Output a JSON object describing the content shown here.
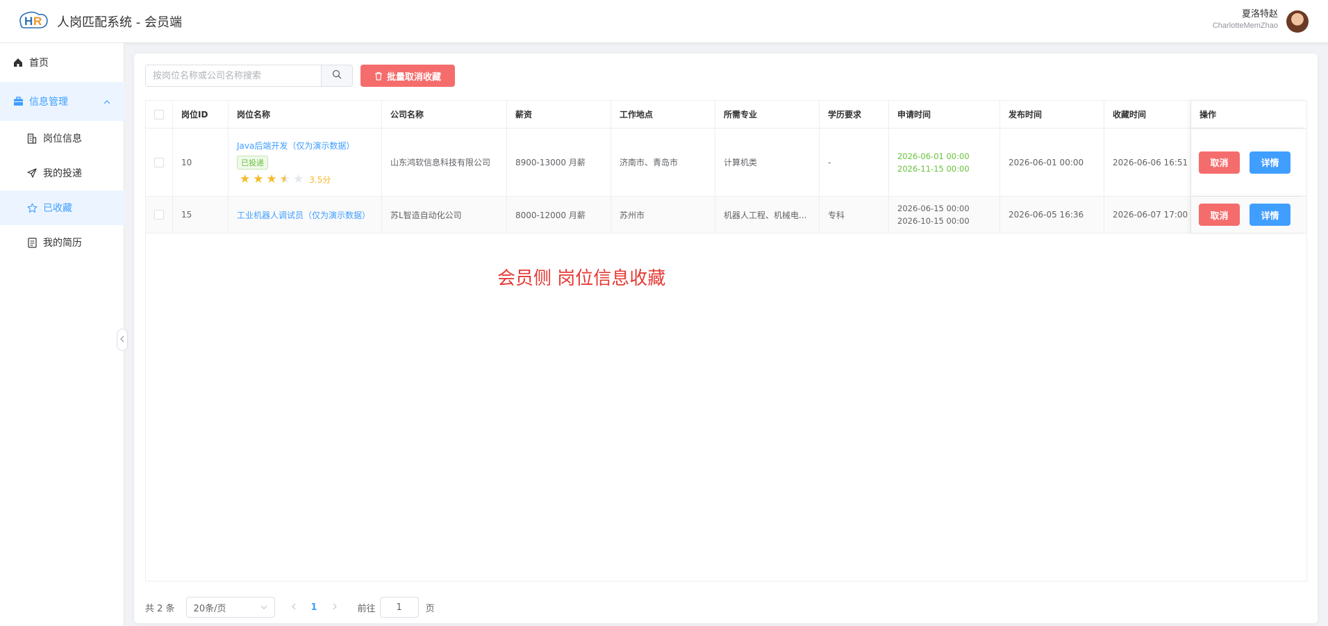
{
  "header": {
    "logo_text": "HR",
    "title": "人岗匹配系统 - 会员端",
    "user_name": "夏洛特赵",
    "user_sub": "CharlotteMemZhao"
  },
  "sidebar": {
    "items": [
      {
        "label": "首页",
        "icon": "home-icon"
      },
      {
        "label": "信息管理",
        "icon": "briefcase-icon"
      },
      {
        "label": "岗位信息",
        "icon": "building-icon"
      },
      {
        "label": "我的投递",
        "icon": "send-icon"
      },
      {
        "label": "已收藏",
        "icon": "star-icon"
      },
      {
        "label": "我的简历",
        "icon": "document-icon"
      }
    ]
  },
  "toolbar": {
    "search_placeholder": "按岗位名称或公司名称搜索",
    "batch_label": "批量取消收藏"
  },
  "table": {
    "headers": [
      "岗位ID",
      "岗位名称",
      "公司名称",
      "薪资",
      "工作地点",
      "所需专业",
      "学历要求",
      "申请时间",
      "发布时间",
      "收藏时间",
      "操作"
    ],
    "rows": [
      {
        "id": "10",
        "title": "Java后端开发（仅为演示数据）",
        "tag": "已投递",
        "rating": 3.5,
        "score": "3.5分",
        "company": "山东鸿软信息科技有限公司",
        "salary": "8900-13000 月薪",
        "location": "济南市、青岛市",
        "major": "计算机类",
        "education": "-",
        "apply_start": "2026-06-01 00:00",
        "apply_end": "2026-11-15 00:00",
        "publish_time": "2026-06-01 00:00",
        "fav_time": "2026-06-06 16:51"
      },
      {
        "id": "15",
        "title": "工业机器人调试员（仅为演示数据）",
        "company": "苏L智造自动化公司",
        "salary": "8000-12000 月薪",
        "location": "苏州市",
        "major": "机器人工程、机械电...",
        "education": "专科",
        "apply_start": "2026-06-15 00:00",
        "apply_end": "2026-10-15 00:00",
        "publish_time": "2026-06-05 16:36",
        "fav_time": "2026-06-07 17:00"
      }
    ],
    "cancel_label": "取消",
    "detail_label": "详情"
  },
  "annotation": "会员侧 岗位信息收藏",
  "pagination": {
    "total": "共 2 条",
    "page_size": "20条/页",
    "current_page": "1",
    "goto_label": "前往",
    "goto_value": "1",
    "goto_suffix": "页"
  },
  "colors": {
    "primary": "#409eff",
    "danger": "#f56c6c",
    "success": "#67c23a",
    "rating": "#f7ba2a"
  }
}
